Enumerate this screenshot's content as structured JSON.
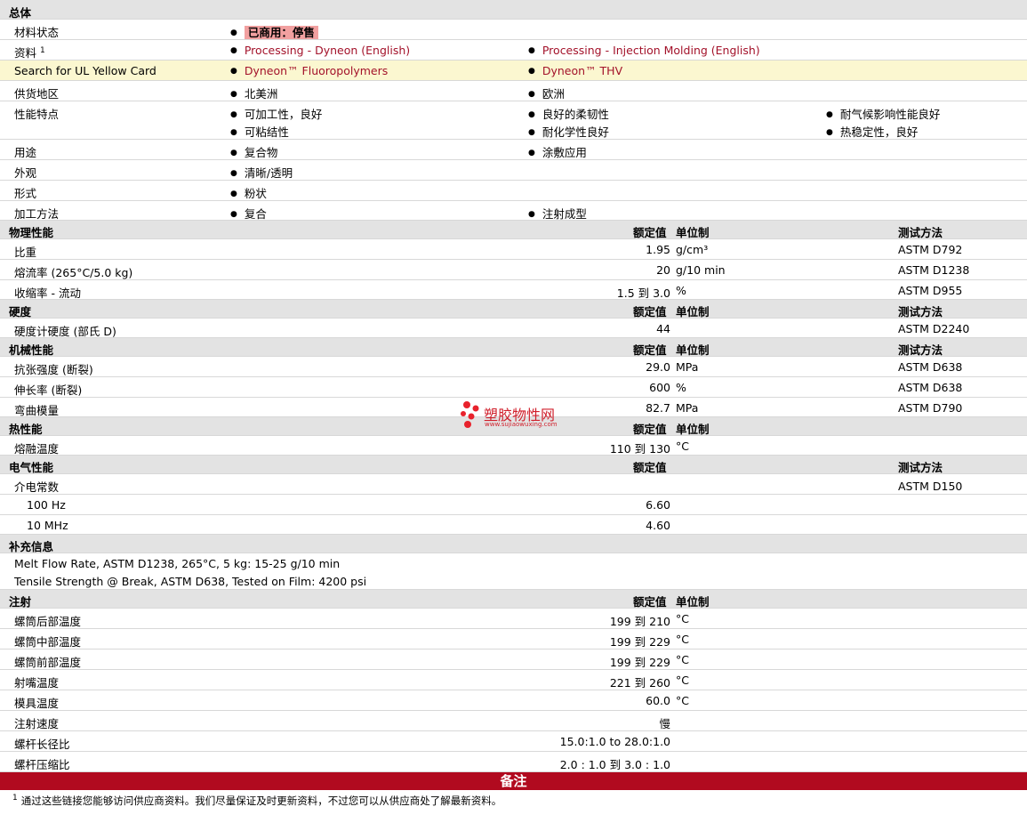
{
  "general": {
    "title": "总体",
    "status_label": "材料状态",
    "status_value": "已商用：停售",
    "docs_label": "资料",
    "docs_sup": "1",
    "doc1": "Processing - Dyneon (English)",
    "doc2": "Processing - Injection Molding (English)",
    "ul_label": "Search for UL Yellow Card",
    "ul1": "Dyneon™ Fluoropolymers",
    "ul2": "Dyneon™ THV",
    "region_label": "供货地区",
    "region1": "北美洲",
    "region2": "欧洲",
    "feat_label": "性能特点",
    "feat": [
      "可加工性，良好",
      "良好的柔韧性",
      "耐气候影响性能良好",
      "可粘结性",
      "耐化学性良好",
      "热稳定性，良好"
    ],
    "use_label": "用途",
    "use1": "复合物",
    "use2": "涂敷应用",
    "look_label": "外观",
    "look1": "清晰/透明",
    "form_label": "形式",
    "form1": "粉状",
    "proc_label": "加工方法",
    "proc1": "复合",
    "proc2": "注射成型"
  },
  "col": {
    "value": "额定值",
    "unit": "单位制",
    "test": "测试方法"
  },
  "physical": {
    "title": "物理性能",
    "rows": [
      {
        "name": "比重",
        "value": "1.95",
        "unit": "g/cm³",
        "test": "ASTM D792"
      },
      {
        "name": "熔流率 (265°C/5.0 kg)",
        "value": "20",
        "unit": "g/10 min",
        "test": "ASTM D1238"
      },
      {
        "name": "收缩率 - 流动",
        "value": "1.5 到  3.0",
        "unit": "%",
        "test": "ASTM D955"
      }
    ]
  },
  "hardness": {
    "title": "硬度",
    "rows": [
      {
        "name": "硬度计硬度 (部氏 D)",
        "value": "44",
        "unit": "",
        "test": "ASTM D2240"
      }
    ]
  },
  "mechanical": {
    "title": "机械性能",
    "rows": [
      {
        "name": "抗张强度 (断裂)",
        "value": "29.0",
        "unit": "MPa",
        "test": "ASTM D638"
      },
      {
        "name": "伸长率 (断裂)",
        "value": "600",
        "unit": "%",
        "test": "ASTM D638"
      },
      {
        "name": "弯曲模量",
        "value": "82.7",
        "unit": "MPa",
        "test": "ASTM D790"
      }
    ]
  },
  "thermal": {
    "title": "热性能",
    "rows": [
      {
        "name": "熔融温度",
        "value": "110 到  130",
        "unit": "°C",
        "test": ""
      }
    ]
  },
  "electrical": {
    "title": "电气性能",
    "rows": [
      {
        "name": "介电常数",
        "value": "",
        "unit": "",
        "test": "ASTM D150"
      },
      {
        "name": "100 Hz",
        "value": "6.60",
        "unit": "",
        "test": ""
      },
      {
        "name": "10 MHz",
        "value": "4.60",
        "unit": "",
        "test": ""
      }
    ]
  },
  "supplement": {
    "title": "补充信息",
    "line1": "Melt Flow Rate, ASTM D1238, 265°C, 5 kg: 15-25 g/10 min",
    "line2": "Tensile Strength @ Break, ASTM D638, Tested on Film: 4200 psi"
  },
  "injection": {
    "title": "注射",
    "rows": [
      {
        "name": "螺筒后部温度",
        "value": "199 到  210",
        "unit": "°C"
      },
      {
        "name": "螺筒中部温度",
        "value": "199 到  229",
        "unit": "°C"
      },
      {
        "name": "螺筒前部温度",
        "value": "199 到  229",
        "unit": "°C"
      },
      {
        "name": "射嘴温度",
        "value": "221 到  260",
        "unit": "°C"
      },
      {
        "name": "模具温度",
        "value": "60.0",
        "unit": "°C"
      },
      {
        "name": "注射速度",
        "value": "慢",
        "unit": ""
      },
      {
        "name": "螺杆长径比",
        "value": "15.0:1.0 to 28.0:1.0",
        "unit": ""
      },
      {
        "name": "螺杆压缩比",
        "value": "2.0 : 1.0 到  3.0 : 1.0",
        "unit": ""
      }
    ]
  },
  "notes": {
    "title": "备注",
    "sup": "1",
    "text": "通过这些链接您能够访问供应商资料。我们尽量保证及时更新资料，不过您可以从供应商处了解最新资料。"
  },
  "watermark": {
    "cn": "塑胶物性网",
    "url": "www.sujiaowuxing.com"
  },
  "colors": {
    "link": "#a3122a",
    "notes_bar": "#b10a1f",
    "header": "#e3e3e3",
    "highlight": "#fbf7d0"
  }
}
